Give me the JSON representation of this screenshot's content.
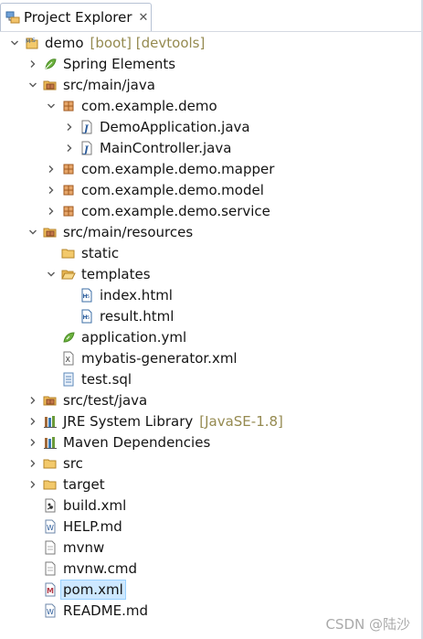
{
  "tab": {
    "title": "Project Explorer",
    "close_glyph": "✕"
  },
  "tree": [
    {
      "label": "demo",
      "decor": "[boot] [devtools]",
      "icon": "project",
      "twisty": "expanded",
      "level": 0
    },
    {
      "label": "Spring Elements",
      "icon": "spring",
      "twisty": "collapsed",
      "level": 1
    },
    {
      "label": "src/main/java",
      "icon": "srcfolder",
      "twisty": "expanded",
      "level": 1
    },
    {
      "label": "com.example.demo",
      "icon": "package",
      "twisty": "expanded",
      "level": 2
    },
    {
      "label": "DemoApplication.java",
      "icon": "java",
      "twisty": "collapsed",
      "level": 3
    },
    {
      "label": "MainController.java",
      "icon": "java",
      "twisty": "collapsed",
      "level": 3
    },
    {
      "label": "com.example.demo.mapper",
      "icon": "package",
      "twisty": "collapsed",
      "level": 2
    },
    {
      "label": "com.example.demo.model",
      "icon": "package",
      "twisty": "collapsed",
      "level": 2
    },
    {
      "label": "com.example.demo.service",
      "icon": "package",
      "twisty": "collapsed",
      "level": 2
    },
    {
      "label": "src/main/resources",
      "icon": "srcfolder",
      "twisty": "expanded",
      "level": 1
    },
    {
      "label": "static",
      "icon": "folder",
      "twisty": "none",
      "level": 2
    },
    {
      "label": "templates",
      "icon": "folder-open",
      "twisty": "expanded",
      "level": 2
    },
    {
      "label": "index.html",
      "icon": "html",
      "twisty": "none",
      "level": 3
    },
    {
      "label": "result.html",
      "icon": "html",
      "twisty": "none",
      "level": 3
    },
    {
      "label": "application.yml",
      "icon": "yml",
      "twisty": "none",
      "level": 2
    },
    {
      "label": "mybatis-generator.xml",
      "icon": "xml",
      "twisty": "none",
      "level": 2
    },
    {
      "label": "test.sql",
      "icon": "sql",
      "twisty": "none",
      "level": 2
    },
    {
      "label": "src/test/java",
      "icon": "srcfolder",
      "twisty": "collapsed",
      "level": 1
    },
    {
      "label": "JRE System Library",
      "decor": "[JavaSE-1.8]",
      "icon": "library",
      "twisty": "collapsed",
      "level": 1
    },
    {
      "label": "Maven Dependencies",
      "icon": "library",
      "twisty": "collapsed",
      "level": 1
    },
    {
      "label": "src",
      "icon": "folder",
      "twisty": "collapsed",
      "level": 1
    },
    {
      "label": "target",
      "icon": "folder",
      "twisty": "collapsed",
      "level": 1
    },
    {
      "label": "build.xml",
      "icon": "antxml",
      "twisty": "none",
      "level": 1
    },
    {
      "label": "HELP.md",
      "icon": "md",
      "twisty": "none",
      "level": 1
    },
    {
      "label": "mvnw",
      "icon": "file",
      "twisty": "none",
      "level": 1
    },
    {
      "label": "mvnw.cmd",
      "icon": "file",
      "twisty": "none",
      "level": 1
    },
    {
      "label": "pom.xml",
      "icon": "pom",
      "twisty": "none",
      "level": 1,
      "selected": true
    },
    {
      "label": "README.md",
      "icon": "md",
      "twisty": "none",
      "level": 1
    }
  ],
  "watermark": "CSDN @陆沙",
  "colors": {
    "selection": "#cde8ff",
    "decoration": "#958a50",
    "folder": "#e8b04a",
    "package": "#c56e2c"
  }
}
